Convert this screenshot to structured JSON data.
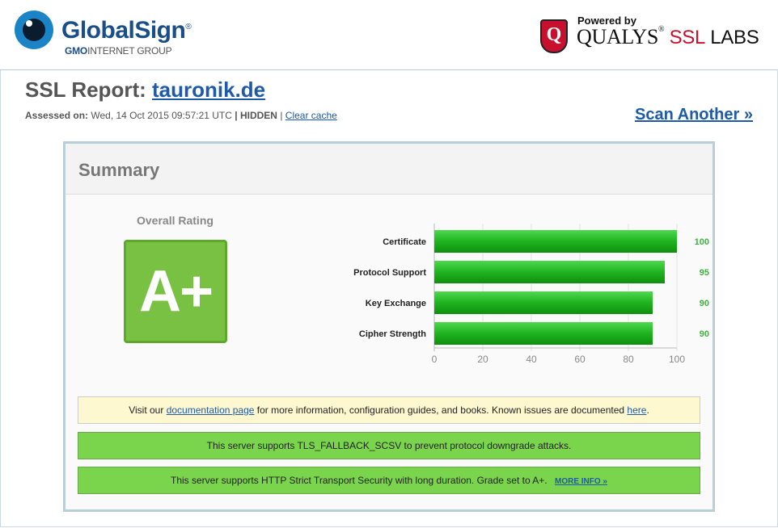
{
  "header": {
    "globalsign": {
      "name": "GlobalSign",
      "reg": "®",
      "sub_bold": "GMO",
      "sub_rest": "INTERNET GROUP"
    },
    "qualys": {
      "powered": "Powered by",
      "brand": "QUALYS",
      "reg": "®",
      "ssl": "SSL",
      "labs": "LABS",
      "shield": "Q"
    }
  },
  "report": {
    "title_prefix": "SSL Report:",
    "domain": "tauronik.de",
    "assessed_label": "Assessed on:",
    "assessed_value": "Wed, 14 Oct 2015 09:57:21 UTC",
    "separator": "|",
    "hidden": "HIDDEN",
    "clear_cache": "Clear cache",
    "scan_another": "Scan Another »"
  },
  "summary": {
    "title": "Summary",
    "overall_label": "Overall Rating",
    "grade": "A+",
    "grade_color": "#78c142"
  },
  "chart_data": {
    "type": "bar",
    "orientation": "horizontal",
    "categories": [
      "Certificate",
      "Protocol Support",
      "Key Exchange",
      "Cipher Strength"
    ],
    "values": [
      100,
      95,
      90,
      90
    ],
    "xlim": [
      0,
      100
    ],
    "ticks": [
      0,
      20,
      40,
      60,
      80,
      100
    ],
    "bar_color": "#1fb31f",
    "value_color": "#3cb43c"
  },
  "notices": {
    "info": {
      "pre": "Visit our",
      "doc_link": "documentation page",
      "mid": "for more information, configuration guides, and books. Known issues are documented",
      "here_link": "here",
      "end": "."
    },
    "fallback": "This server supports TLS_FALLBACK_SCSV to prevent protocol downgrade attacks.",
    "hsts": "This server supports HTTP Strict Transport Security with long duration. Grade set to A+.",
    "more_info": "MORE INFO »"
  }
}
